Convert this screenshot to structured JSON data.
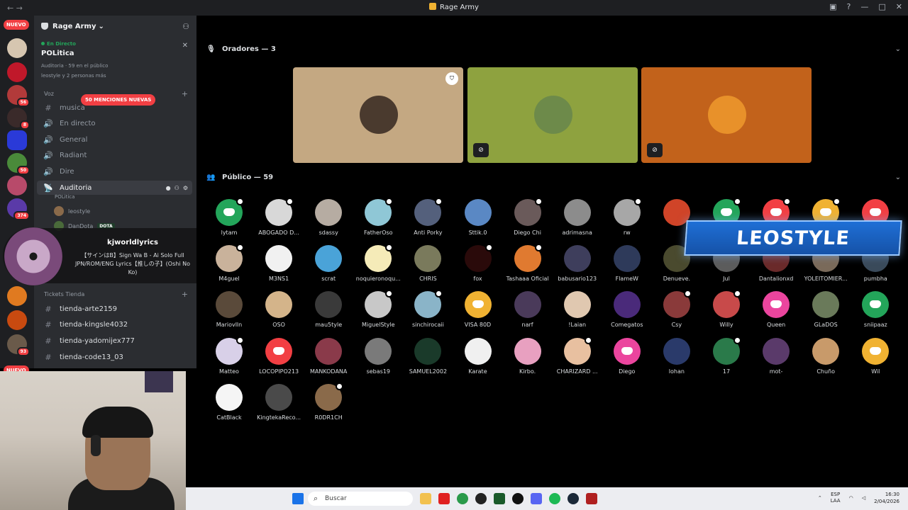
{
  "window": {
    "title": "Rage Army"
  },
  "rail": {
    "nuevo_top": "NUEVO",
    "nuevo_bottom": "NUEVO",
    "badges": [
      "56",
      "8",
      "50",
      "374",
      "93"
    ]
  },
  "sidebar": {
    "server_name": "Rage Army",
    "live": {
      "tag": "En Directo",
      "title": "POLitica",
      "meta": "Auditoria · 59 en el público",
      "people": "leostyle y 2 personas más"
    },
    "mentions_pill": "50 MENCIONES NUEVAS",
    "voice_category": "Voz",
    "channels": [
      {
        "label": "musica",
        "glyph": "#"
      },
      {
        "label": "En directo",
        "glyph": "🔊"
      },
      {
        "label": "General",
        "glyph": "🔊"
      },
      {
        "label": "Radiant",
        "glyph": "🔊"
      },
      {
        "label": "Dire",
        "glyph": "🔊"
      },
      {
        "label": "Auditoria",
        "glyph": "📡"
      }
    ],
    "auditoria_sub": "POLitica",
    "members": [
      {
        "name": "leostyle"
      },
      {
        "name": "DanDota",
        "badge": "DOTA"
      }
    ],
    "tickets_category": "Tickets Tienda",
    "text_channels": [
      "tienda-arte2159",
      "tienda-kingsle4032",
      "tienda-yadomijex777",
      "tienda-code13_03"
    ]
  },
  "music": {
    "author": "kjworldlyrics",
    "song": "【サインはB】Sign Wa B - Ai Solo Full JPN/ROM/ENG Lyrics【推しの子】(Oshi No Ko)"
  },
  "stage": {
    "speakers_header": "Oradores — 3",
    "audience_header": "Público — 59",
    "speakers": [
      {
        "bg": "#c4a882",
        "avatar": "#4a3a2e",
        "moderator": true,
        "muted": false
      },
      {
        "bg": "#8ea23f",
        "avatar": "#6d8a4a",
        "moderator": false,
        "muted": true
      },
      {
        "bg": "#c2621b",
        "avatar": "#e8912a",
        "moderator": false,
        "muted": true
      }
    ],
    "audience": [
      {
        "name": "lytam",
        "color": "#23a55a",
        "discord": true,
        "mark": true
      },
      {
        "name": "ABOGADO D...",
        "color": "#d8d8d8",
        "discord": false,
        "mark": true
      },
      {
        "name": "sdassy",
        "color": "#b6aca2",
        "discord": false,
        "mark": false
      },
      {
        "name": "FatherOso",
        "color": "#8fc7d6",
        "discord": false,
        "mark": true
      },
      {
        "name": "Anti Porky",
        "color": "#54607c",
        "discord": false,
        "mark": true
      },
      {
        "name": "Sttik.0",
        "color": "#5a88c4",
        "discord": false,
        "mark": false
      },
      {
        "name": "Diego Chi",
        "color": "#6a5a5a",
        "discord": false,
        "mark": true
      },
      {
        "name": "adrimasna",
        "color": "#8c8c8c",
        "discord": false,
        "mark": false
      },
      {
        "name": "rw",
        "color": "#a7a7a7",
        "discord": false,
        "mark": true
      },
      {
        "name": "",
        "color": "#d04428",
        "discord": false,
        "mark": false
      },
      {
        "name": "",
        "color": "#23a55a",
        "discord": true,
        "mark": true
      },
      {
        "name": "",
        "color": "#f23f43",
        "discord": true,
        "mark": true
      },
      {
        "name": "",
        "color": "#f0b232",
        "discord": true,
        "mark": true
      },
      {
        "name": "",
        "color": "#f23f43",
        "discord": true,
        "mark": false
      },
      {
        "name": "M4guel",
        "color": "#c9b29b",
        "discord": false,
        "mark": true
      },
      {
        "name": "M3NS1",
        "color": "#f1f1f1",
        "discord": false,
        "mark": false
      },
      {
        "name": "scrat",
        "color": "#4aa3d8",
        "discord": false,
        "mark": false
      },
      {
        "name": "noquieronoqu...",
        "color": "#f5ebb8",
        "discord": false,
        "mark": true
      },
      {
        "name": "CHRIS",
        "color": "#7a7a5c",
        "discord": false,
        "mark": false
      },
      {
        "name": "fox",
        "color": "#2a0a0a",
        "discord": false,
        "mark": true
      },
      {
        "name": "Tashaaa Oficial",
        "color": "#e07a30",
        "discord": false,
        "mark": true
      },
      {
        "name": "babusario123",
        "color": "#3e3e5c",
        "discord": false,
        "mark": false
      },
      {
        "name": "FlameW",
        "color": "#2e3a5a",
        "discord": false,
        "mark": false
      },
      {
        "name": "Denueve.",
        "color": "#4a4a2e",
        "discord": false,
        "mark": false
      },
      {
        "name": "Jul",
        "color": "#5c5c5c",
        "discord": false,
        "mark": false
      },
      {
        "name": "Dantalionxd",
        "color": "#6a2a2a",
        "discord": false,
        "mark": false
      },
      {
        "name": "YOLEITOMIER...",
        "color": "#7a6a5a",
        "discord": false,
        "mark": false
      },
      {
        "name": "pumbha",
        "color": "#3a4a5a",
        "discord": false,
        "mark": false
      },
      {
        "name": "Mariovlln",
        "color": "#5a4a3a",
        "discord": false,
        "mark": false
      },
      {
        "name": "OSO",
        "color": "#d4b48a",
        "discord": false,
        "mark": false
      },
      {
        "name": "mau5tyle",
        "color": "#3a3a3a",
        "discord": false,
        "mark": false
      },
      {
        "name": "MiguelStyle",
        "color": "#c8c8c8",
        "discord": false,
        "mark": true
      },
      {
        "name": "sinchirocaii",
        "color": "#8ab4c8",
        "discord": false,
        "mark": true
      },
      {
        "name": "VISA 80D",
        "color": "#f0b232",
        "discord": true,
        "mark": false
      },
      {
        "name": "narf",
        "color": "#4a3a5a",
        "discord": false,
        "mark": false
      },
      {
        "name": "!Laian",
        "color": "#e0c8b0",
        "discord": false,
        "mark": false
      },
      {
        "name": "Comegatos",
        "color": "#4a2a7a",
        "discord": false,
        "mark": false
      },
      {
        "name": "Csy",
        "color": "#8a3a3a",
        "discord": false,
        "mark": true
      },
      {
        "name": "Willy",
        "color": "#c84a4a",
        "discord": false,
        "mark": true
      },
      {
        "name": "Queen",
        "color": "#eb459e",
        "discord": true,
        "mark": false
      },
      {
        "name": "GLaDOS",
        "color": "#6a7a5a",
        "discord": false,
        "mark": false
      },
      {
        "name": "sniipaaz",
        "color": "#23a55a",
        "discord": true,
        "mark": false
      },
      {
        "name": "Matteo",
        "color": "#d8d0e8",
        "discord": false,
        "mark": true
      },
      {
        "name": "LOCOPIPO213",
        "color": "#f23f43",
        "discord": true,
        "mark": false
      },
      {
        "name": "MANKODANA",
        "color": "#8a3a4a",
        "discord": false,
        "mark": false
      },
      {
        "name": "sebas19",
        "color": "#7a7a7a",
        "discord": false,
        "mark": false
      },
      {
        "name": "SAMUEL2002",
        "color": "#1a3a2a",
        "discord": false,
        "mark": false
      },
      {
        "name": "Karate",
        "color": "#f0f0f0",
        "discord": false,
        "mark": false
      },
      {
        "name": "Kirbo.",
        "color": "#e8a0c0",
        "discord": false,
        "mark": false
      },
      {
        "name": "CHARIZARD ...",
        "color": "#e8c0a0",
        "discord": false,
        "mark": true
      },
      {
        "name": "Diego",
        "color": "#eb459e",
        "discord": true,
        "mark": false
      },
      {
        "name": "lohan",
        "color": "#2a3a6a",
        "discord": false,
        "mark": false
      },
      {
        "name": "17",
        "color": "#2a7a4a",
        "discord": false,
        "mark": true
      },
      {
        "name": "mot-",
        "color": "#5a3a6a",
        "discord": false,
        "mark": false
      },
      {
        "name": "Chuño",
        "color": "#c89a6a",
        "discord": false,
        "mark": false
      },
      {
        "name": "Wil",
        "color": "#f0b232",
        "discord": true,
        "mark": false
      },
      {
        "name": "CatBlack",
        "color": "#f5f5f5",
        "discord": false,
        "mark": false
      },
      {
        "name": "KingtekaReco...",
        "color": "#4a4a4a",
        "discord": false,
        "mark": false
      },
      {
        "name": "R0DR1CH",
        "color": "#8a6a4a",
        "discord": false,
        "mark": true
      }
    ]
  },
  "overlay": {
    "banner_text": "LEOSTYLE"
  },
  "taskbar": {
    "search_placeholder": "Buscar",
    "lang": "ESP",
    "lang2": "LAA",
    "time": "16:30",
    "date": "2/04/2026"
  },
  "colors": {
    "accent": "#5865f2",
    "danger": "#f23f43",
    "green": "#23a55a"
  }
}
